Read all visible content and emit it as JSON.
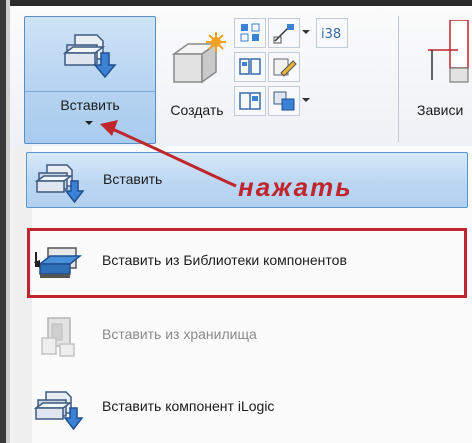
{
  "ribbon": {
    "insert_button_label": "Вставить",
    "create_button_label": "Создать",
    "dependencies_label": "Зависи"
  },
  "menu": {
    "items": [
      {
        "label": "Вставить",
        "state": "highlighted"
      },
      {
        "label": "Вставить из Библиотеки компонентов",
        "state": "normal"
      },
      {
        "label": "Вставить из хранилища",
        "state": "disabled"
      },
      {
        "label": "Вставить компонент iLogic",
        "state": "normal"
      }
    ]
  },
  "annotation": {
    "text": "нажать",
    "color": "#c0262d"
  },
  "colors": {
    "highlight": "#bcd7f2",
    "highlight_border": "#5e94cc",
    "annotation_red": "#c0262d"
  }
}
